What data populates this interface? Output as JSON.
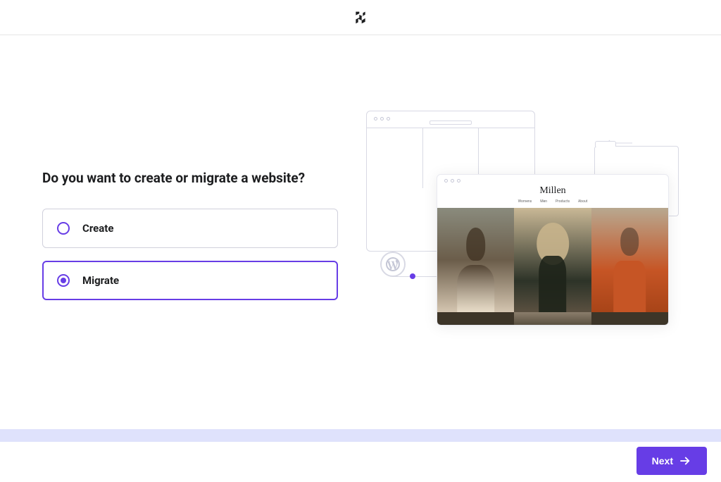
{
  "question": "Do you want to create or migrate a website?",
  "options": {
    "create": {
      "label": "Create",
      "selected": false
    },
    "migrate": {
      "label": "Migrate",
      "selected": true
    }
  },
  "preview": {
    "site_title": "Millen",
    "nav": {
      "item1": "Womens",
      "item2": "Men",
      "item3": "Products",
      "item4": "About"
    }
  },
  "next_button": "Next"
}
